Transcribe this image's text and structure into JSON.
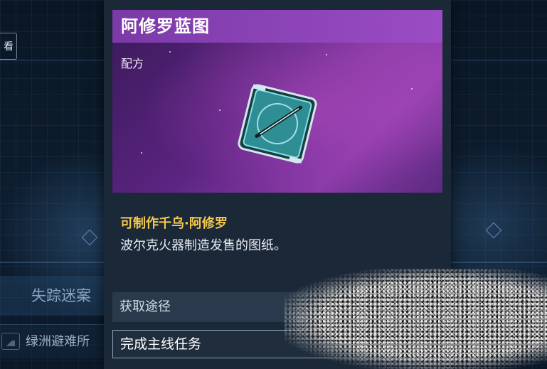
{
  "background": {
    "chip_label": "看",
    "section_label": "失踪迷案",
    "list_item_label": "绿洲避难所",
    "list_item_icon": "image-icon"
  },
  "item": {
    "name": "阿修罗蓝图",
    "category": "配方",
    "icon": "blueprint-icon",
    "craft_line": "可制作千乌·阿修罗",
    "description": "波尔克火器制造发售的图纸。",
    "rarity_color": "#9b4cc4"
  },
  "source": {
    "header": "获取途径",
    "entries": [
      "完成主线任务"
    ]
  },
  "colors": {
    "craft_highlight": "#f2c94c",
    "panel_bg": "#1b2838"
  }
}
